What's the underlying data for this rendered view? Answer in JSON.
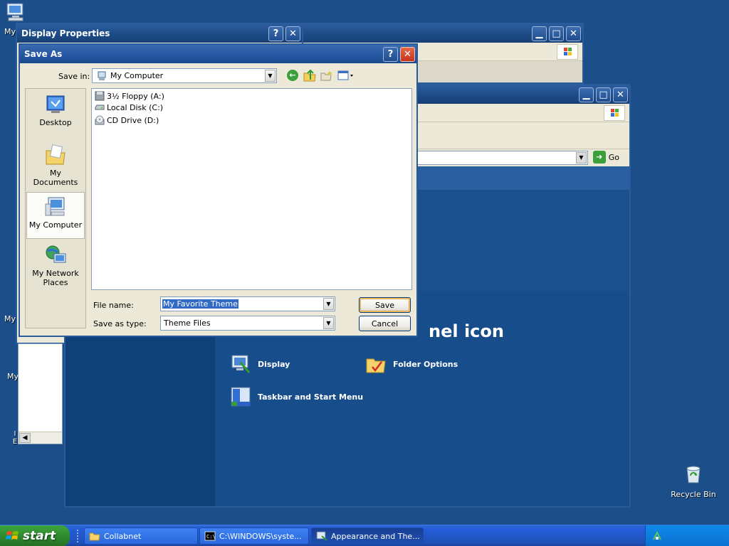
{
  "desktop": {
    "icons": [
      {
        "label": "My",
        "icon": "my-computer-icon"
      },
      {
        "label": "My",
        "icon": "my-documents-icon"
      },
      {
        "label": "My",
        "icon": "my-network-icon"
      },
      {
        "label": "I E",
        "icon": "ie-icon"
      },
      {
        "label": "Recycle Bin",
        "icon": "recycle-bin-icon"
      }
    ]
  },
  "display_properties": {
    "title": "Display Properties",
    "help_label": "?",
    "close_label": "✕"
  },
  "explorer_back": {
    "minimize_label": "▁",
    "maximize_label": "□",
    "close_label": "✕"
  },
  "control_panel": {
    "address_go": "Go",
    "heading": "nel icon",
    "items": [
      {
        "label": "Display",
        "icon": "display-icon"
      },
      {
        "label": "Folder Options",
        "icon": "folder-options-icon"
      },
      {
        "label": "Taskbar and Start Menu",
        "icon": "taskbar-icon"
      }
    ]
  },
  "save_as": {
    "title": "Save As",
    "help_label": "?",
    "close_label": "✕",
    "save_in_label": "Save in:",
    "save_in_value": "My Computer",
    "places": [
      {
        "label": "Desktop",
        "icon": "desktop-icon"
      },
      {
        "label": "My Documents",
        "icon": "my-documents-icon"
      },
      {
        "label": "My Computer",
        "icon": "my-computer-icon"
      },
      {
        "label": "My Network Places",
        "icon": "my-network-places-icon"
      }
    ],
    "files": [
      {
        "label": "3½ Floppy (A:)",
        "icon": "floppy-drive-icon"
      },
      {
        "label": "Local Disk (C:)",
        "icon": "hard-disk-icon"
      },
      {
        "label": "CD Drive (D:)",
        "icon": "cd-drive-icon"
      }
    ],
    "file_name_label": "File name:",
    "file_name_value": "My Favorite Theme",
    "save_type_label": "Save as type:",
    "save_type_value": "Theme Files",
    "save_button": "Save",
    "cancel_button": "Cancel"
  },
  "taskbar": {
    "start_label": "start",
    "tasks": [
      {
        "label": "Collabnet",
        "icon": "folder-icon"
      },
      {
        "label": "C:\\WINDOWS\\syste...",
        "icon": "console-icon"
      },
      {
        "label": "Appearance and The...",
        "icon": "control-panel-icon"
      }
    ]
  },
  "colors": {
    "desktop": "#1c4f8a",
    "title_bar": "#2455a0",
    "dialog_face": "#ece9d8",
    "selection": "#316ac5",
    "start_green": "#2f8a2f"
  }
}
